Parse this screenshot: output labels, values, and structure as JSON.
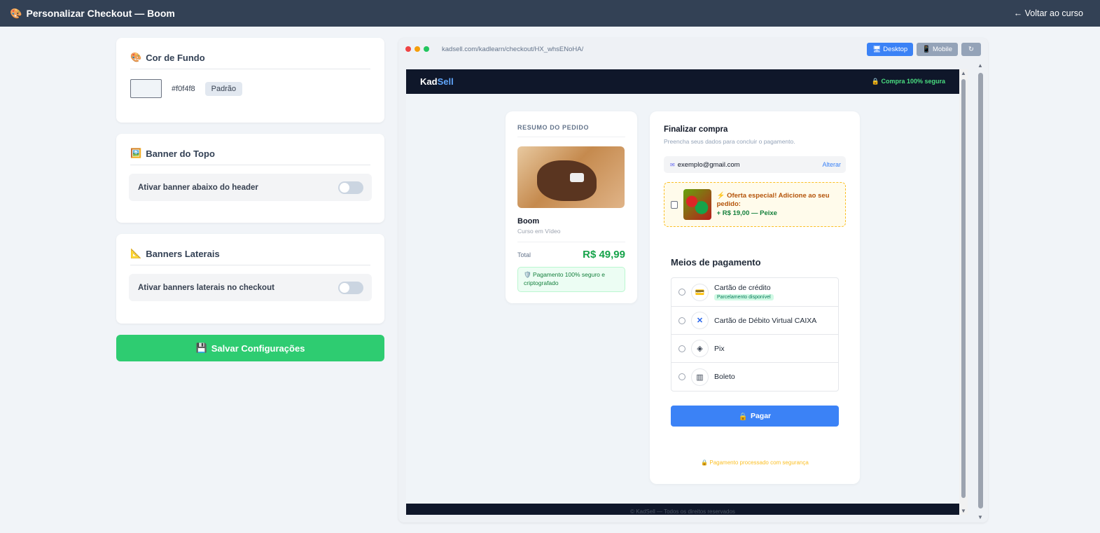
{
  "topbar": {
    "title_icon": "🎨",
    "title": "Personalizar Checkout — Boom",
    "back_label": "← Voltar ao curso"
  },
  "panel": {
    "bg_card": {
      "icon": "🎨",
      "title": "Cor de Fundo",
      "hex_value": "#f0f4f8",
      "default_button": "Padrão"
    },
    "banner_card": {
      "icon": "🖼️",
      "title": "Banner do Topo",
      "toggle_label": "Ativar banner abaixo do header"
    },
    "side_card": {
      "icon": "📐",
      "title": "Banners Laterais",
      "toggle_label": "Ativar banners laterais no checkout"
    },
    "save_icon": "💾",
    "save_label": "Salvar Configurações"
  },
  "preview": {
    "url": "kadsell.com/kadlearn/checkout/HX_whsENoHA/",
    "desktop_icon": "🖥",
    "desktop_label": "Desktop",
    "mobile_icon": "📱",
    "mobile_label": "Mobile",
    "refresh_icon": "↻"
  },
  "checkout_page": {
    "logo_a": "Kad",
    "logo_b": "Sell",
    "secure_label": "🔒 Compra 100% segura",
    "order": {
      "heading": "RESUMO DO PEDIDO",
      "product_name": "Boom",
      "product_type": "Curso em Vídeo",
      "total_label": "Total",
      "total_value": "R$ 49,99",
      "secure_note": "🛡️ Pagamento 100% seguro e criptografado"
    },
    "form": {
      "title": "Finalizar compra",
      "subtitle": "Preencha seus dados para concluir o pagamento.",
      "email_icon": "✉",
      "email": "exemplo@gmail.com",
      "change_label": "Alterar",
      "offer_text": "⚡ Oferta especial! Adicione ao seu pedido:",
      "offer_price": "+ R$ 19,00 — Peixe",
      "payment_title": "Meios de pagamento",
      "methods": [
        {
          "label": "Cartão de crédito",
          "icon": "💳",
          "badge": "Parcelamento disponível"
        },
        {
          "label": "Cartão de Débito Virtual CAIXA",
          "icon": "✕"
        },
        {
          "label": "Pix",
          "icon": "◈"
        },
        {
          "label": "Boleto",
          "icon": "▥"
        }
      ],
      "pay_icon": "🔒",
      "pay_label": "Pagar",
      "processed_note": "🔒 Pagamento processado com segurança"
    },
    "footer": "© KadSell — Todos os direitos reservados"
  }
}
